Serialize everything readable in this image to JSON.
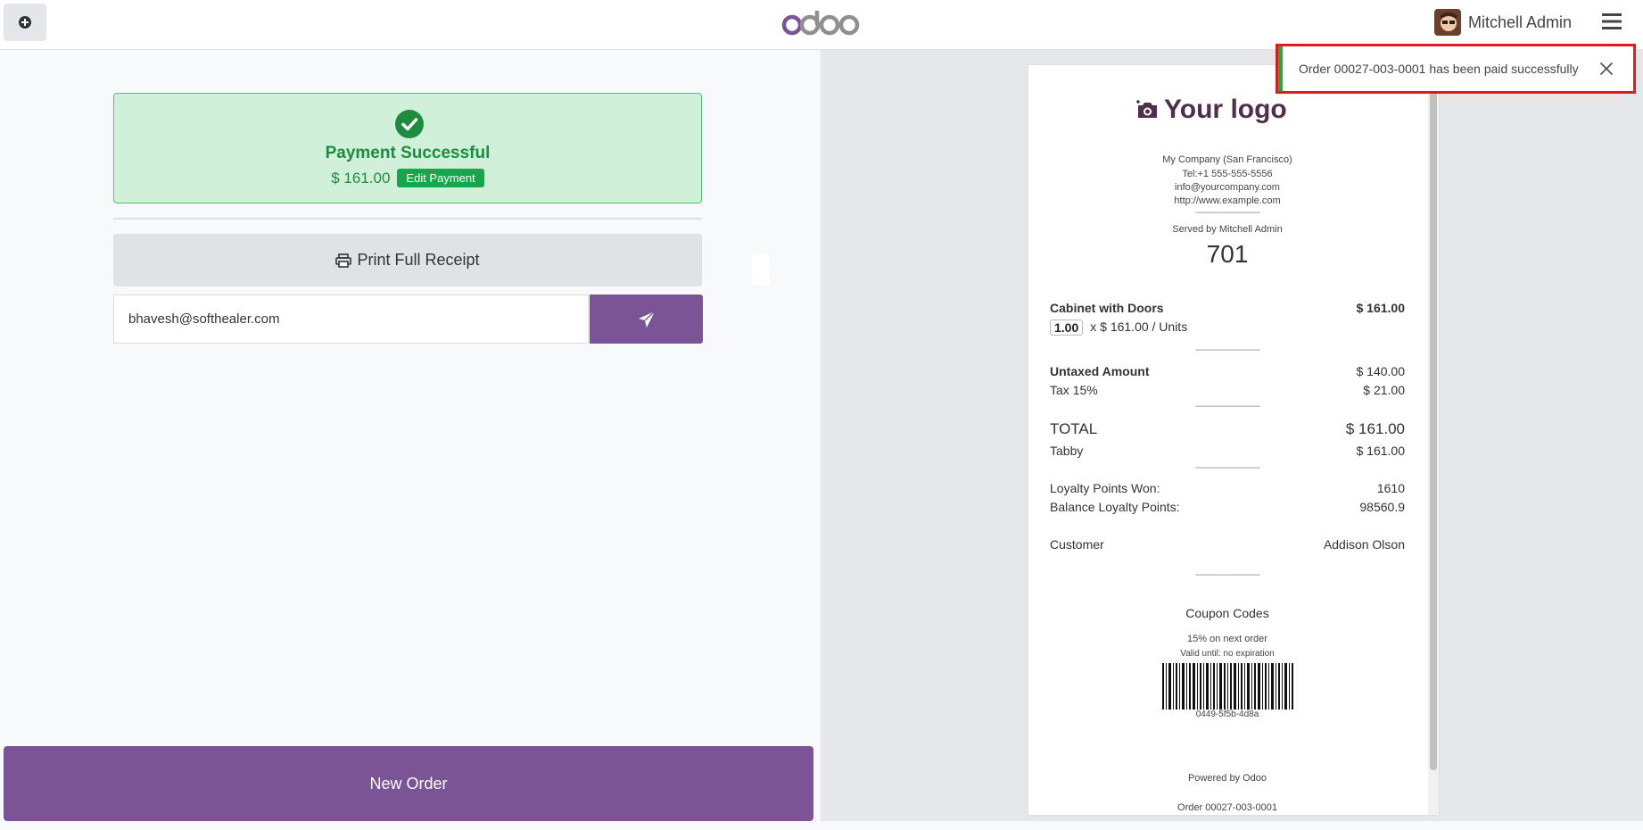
{
  "header": {
    "logo_text": "odoo",
    "user_name": "Mitchell Admin"
  },
  "payment": {
    "title": "Payment Successful",
    "amount": "$ 161.00",
    "edit_label": "Edit Payment"
  },
  "actions": {
    "print_label": "Print Full Receipt",
    "email_value": "bhavesh@softhealer.com",
    "new_order_label": "New Order"
  },
  "toast": {
    "message": "Order 00027-003-0001 has been paid successfully"
  },
  "receipt": {
    "logo_text": "Your logo",
    "company": "My Company (San Francisco)",
    "tel": "Tel:+1 555-555-5556",
    "email": "info@yourcompany.com",
    "website": "http://www.example.com",
    "served_by": "Served by Mitchell Admin",
    "tracking": "701",
    "line_product": "Cabinet with Doors",
    "line_price": "$ 161.00",
    "line_qty": "1.00",
    "line_unit": "x $ 161.00 / Units",
    "untaxed_label": "Untaxed Amount",
    "untaxed_value": "$ 140.00",
    "tax_label": "Tax 15%",
    "tax_value": "$ 21.00",
    "total_label": "TOTAL",
    "total_value": "$ 161.00",
    "payment_method": "Tabby",
    "payment_value": "$ 161.00",
    "loyalty_won_label": "Loyalty Points Won:",
    "loyalty_won_value": "1610",
    "loyalty_balance_label": "Balance Loyalty Points:",
    "loyalty_balance_value": "98560.9",
    "customer_label": "Customer",
    "customer_value": "Addison Olson",
    "coupon_title": "Coupon Codes",
    "coupon_desc": "15% on next order",
    "coupon_valid": "Valid until: no expiration",
    "coupon_code": "0449-5f5b-4d8a",
    "powered_by": "Powered by Odoo",
    "order_ref": "Order 00027-003-0001",
    "separator": "-------------------------------"
  },
  "colors": {
    "brand_purple": "#7a5495",
    "success_green": "#1e8c3e",
    "success_bg": "#d0f0da",
    "highlight_red": "#e01b1b"
  }
}
